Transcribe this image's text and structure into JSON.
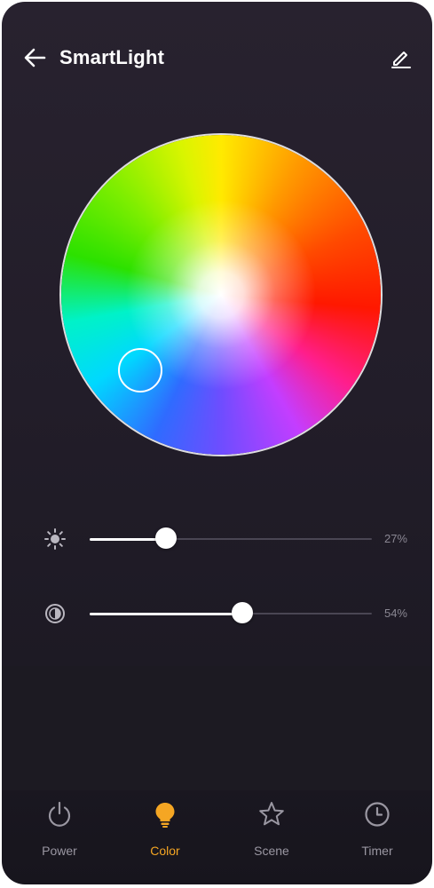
{
  "header": {
    "title": "SmartLight",
    "back_icon": "arrow-left-icon",
    "edit_icon": "pencil-icon"
  },
  "color_wheel": {
    "selected_color_hint": "cyan"
  },
  "sliders": {
    "brightness": {
      "icon": "sun-icon",
      "value_label": "27%",
      "value": 0.27
    },
    "saturation": {
      "icon": "contrast-icon",
      "value_label": "54%",
      "value": 0.54
    }
  },
  "tabs": [
    {
      "label": "Power",
      "icon": "power-icon",
      "active": false
    },
    {
      "label": "Color",
      "icon": "bulb-icon",
      "active": true
    },
    {
      "label": "Scene",
      "icon": "star-icon",
      "active": false
    },
    {
      "label": "Timer",
      "icon": "clock-icon",
      "active": false
    }
  ],
  "colors": {
    "accent": "#f5a623",
    "inactive": "#9a97a2",
    "background": "#221d29"
  }
}
